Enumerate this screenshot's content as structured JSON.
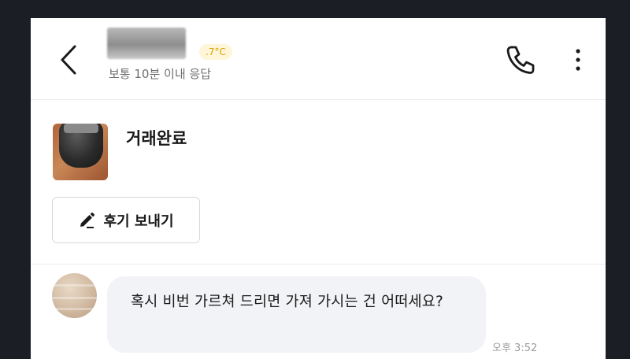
{
  "header": {
    "temperature_badge": ".7°C",
    "response_time": "보통 10분 이내 응답"
  },
  "product": {
    "status": "거래완료",
    "review_button_label": "후기 보내기"
  },
  "chat": {
    "messages": [
      {
        "text": "혹시 비번 가르쳐 드리면 가져 가시는 건 어떠세요?",
        "time": "오후 3:52"
      }
    ]
  },
  "icons": {
    "back": "chevron-left-icon",
    "call": "phone-icon",
    "more": "more-vertical-icon",
    "review": "pencil-icon"
  },
  "colors": {
    "app_background": "#1b1e24",
    "bubble_background": "#f2f3f6",
    "temperature_text": "#d9a300",
    "temperature_background": "#fff5d8"
  }
}
